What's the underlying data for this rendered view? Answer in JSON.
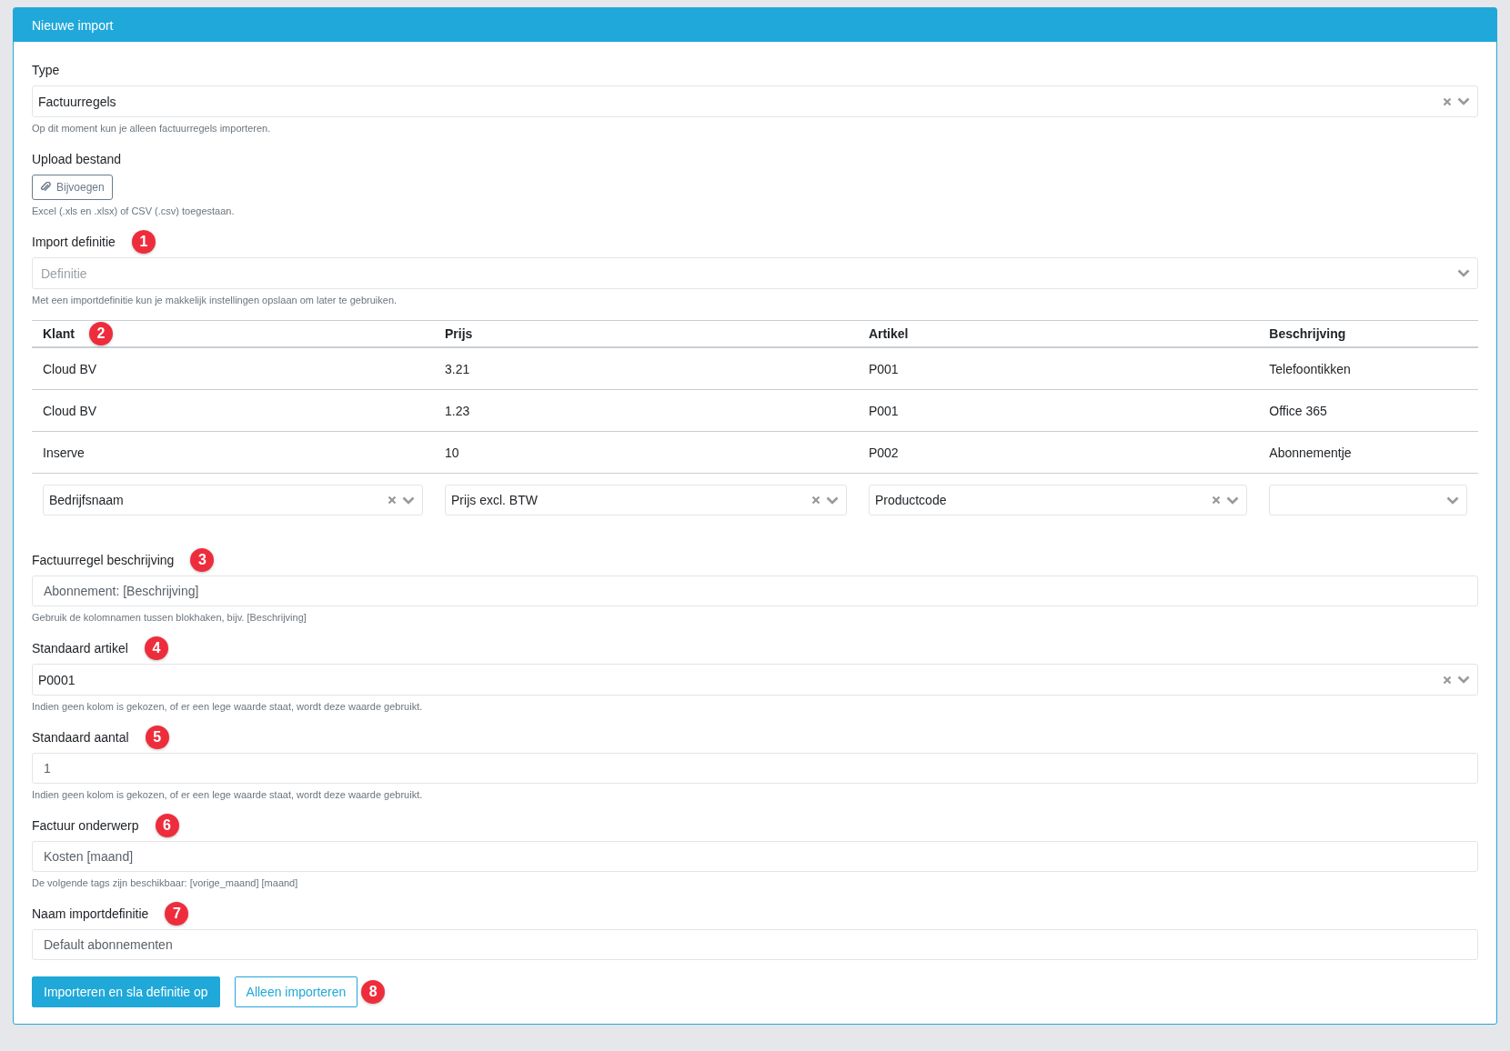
{
  "panel": {
    "title": "Nieuwe import"
  },
  "fields_top": [
    {
      "kind": "select",
      "label": "Type",
      "value": "Factuurregels",
      "clearable": true,
      "help": "Op dit moment kun je alleen factuurregels importeren."
    },
    {
      "kind": "file",
      "label": "Upload bestand",
      "button": "Bijvoegen",
      "help": "Excel (.xls en .xlsx) of CSV (.csv) toegestaan."
    },
    {
      "kind": "select",
      "label": "Import definitie",
      "badge": "1",
      "placeholder": "Definitie",
      "clearable": false,
      "help": "Met een importdefinitie kun je makkelijk instellingen opslaan om later te gebruiken."
    }
  ],
  "table": {
    "badge": "2",
    "columns": [
      "Klant",
      "Prijs",
      "Artikel",
      "Beschrijving"
    ],
    "rows": [
      [
        "Cloud BV",
        "3.21",
        "P001",
        "Telefoontikken"
      ],
      [
        "Cloud BV",
        "1.23",
        "P001",
        "Office 365"
      ],
      [
        "Inserve",
        "10",
        "P002",
        "Abonnementje"
      ]
    ],
    "mappings": [
      {
        "value": "Bedrijfsnaam",
        "clearable": true
      },
      {
        "value": "Prijs excl. BTW",
        "clearable": true
      },
      {
        "value": "Productcode",
        "clearable": true
      },
      {
        "clearable": false
      }
    ]
  },
  "fields_bottom": [
    {
      "kind": "text",
      "label": "Factuurregel beschrijving",
      "badge": "3",
      "value": "Abonnement: [Beschrijving]",
      "help": "Gebruik de kolomnamen tussen blokhaken, bijv. [Beschrijving]"
    },
    {
      "kind": "select",
      "label": "Standaard artikel",
      "badge": "4",
      "value": "P0001",
      "clearable": true,
      "help": "Indien geen kolom is gekozen, of er een lege waarde staat, wordt deze waarde gebruikt."
    },
    {
      "kind": "text",
      "label": "Standaard aantal",
      "badge": "5",
      "value": "1",
      "help": "Indien geen kolom is gekozen, of er een lege waarde staat, wordt deze waarde gebruikt."
    },
    {
      "kind": "text",
      "label": "Factuur onderwerp",
      "badge": "6",
      "value": "Kosten [maand]",
      "help": "De volgende tags zijn beschikbaar: [vorige_maand] [maand]"
    },
    {
      "kind": "text",
      "label": "Naam importdefinitie",
      "badge": "7",
      "value": "Default abonnementen"
    }
  ],
  "buttons": [
    {
      "kind": "primary",
      "label": "Importeren en sla definitie op"
    },
    {
      "kind": "outline",
      "label": "Alleen importeren"
    }
  ],
  "buttons_badge": "8"
}
